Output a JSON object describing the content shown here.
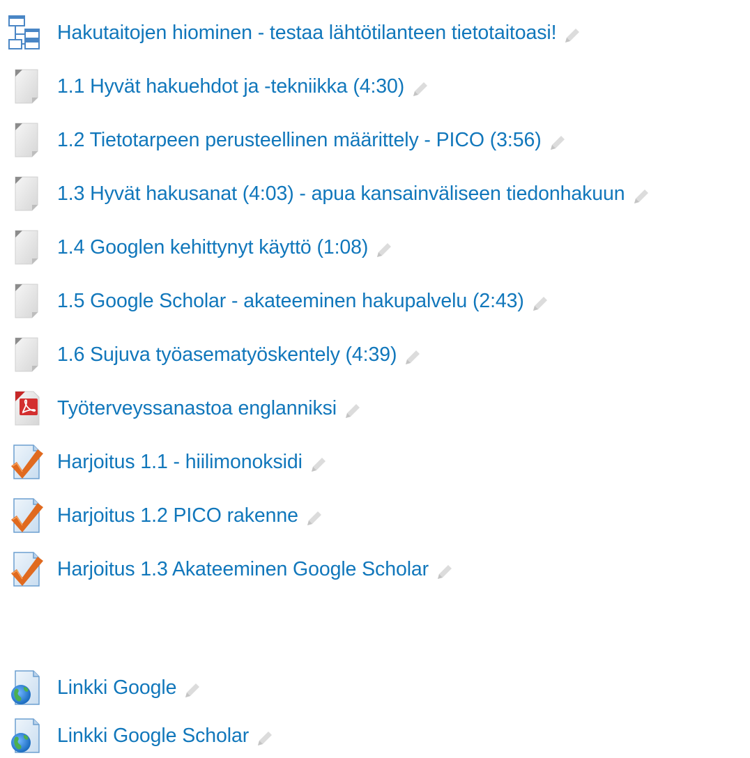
{
  "activities": [
    {
      "label": "Hakutaitojen hiominen - testaa lähtötilanteen tietotaitoasi!",
      "icon": "folder-tree-icon"
    },
    {
      "label": "1.1 Hyvät hakuehdot ja -tekniikka (4:30)",
      "icon": "page-icon"
    },
    {
      "label": "1.2 Tietotarpeen perusteellinen määrittely - PICO (3:56)",
      "icon": "page-icon"
    },
    {
      "label": "1.3 Hyvät hakusanat (4:03) - apua kansainväliseen tiedonhakuun",
      "icon": "page-icon"
    },
    {
      "label": "1.4 Googlen kehittynyt käyttö (1:08)",
      "icon": "page-icon"
    },
    {
      "label": "1.5 Google Scholar - akateeminen hakupalvelu (2:43)",
      "icon": "page-icon"
    },
    {
      "label": "1.6 Sujuva työasematyöskentely (4:39)",
      "icon": "page-icon"
    },
    {
      "label": "Työterveyssanastoa englanniksi",
      "icon": "pdf-icon"
    },
    {
      "label": "Harjoitus 1.1 - hiilimonoksidi",
      "icon": "assignment-icon"
    },
    {
      "label": "Harjoitus 1.2 PICO rakenne",
      "icon": "assignment-icon"
    },
    {
      "label": "Harjoitus 1.3 Akateeminen Google Scholar",
      "icon": "assignment-icon"
    },
    {
      "label": "Linkki Google",
      "icon": "url-icon"
    },
    {
      "label": "Linkki Google Scholar",
      "icon": "url-icon"
    }
  ],
  "colors": {
    "link": "#1177bb",
    "edit_icon": "#cfcfcf",
    "pdf_red": "#d32f2f",
    "check_orange": "#e06a1f"
  }
}
